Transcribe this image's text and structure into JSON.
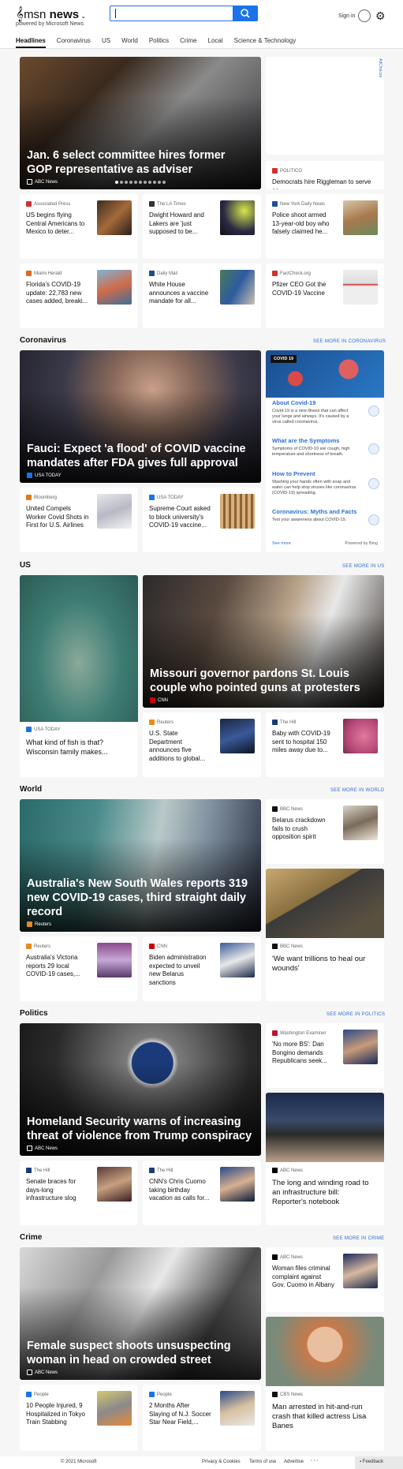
{
  "header": {
    "brand": "msn",
    "brand_suffix": "news",
    "powered": "powered by Microsoft News",
    "signin": "Sign in",
    "search_value": ""
  },
  "nav": [
    "Headlines",
    "Coronavirus",
    "US",
    "World",
    "Politics",
    "Crime",
    "Local",
    "Science & Technology"
  ],
  "top": {
    "hero": {
      "title": "Jan. 6 select committee hires former GOP representative as adviser",
      "source": "ABC News"
    },
    "ad_label": "AdChoices",
    "side": {
      "source": "POLITICO",
      "title": "Democrats hire Riggleman to serve as..."
    },
    "row1": [
      {
        "source": "Associated Press",
        "title": "US begins flying Central Americans to Mexico to deter..."
      },
      {
        "source": "The LA Times",
        "title": "Dwight Howard and Lakers are 'just supposed to be..."
      },
      {
        "source": "New York Daily News",
        "title": "Police shoot armed 13-year-old boy who falsely claimed he..."
      }
    ],
    "row2": [
      {
        "source": "Miami Herald",
        "title": "Florida's COVID-19 update: 22,783 new cases added, breaki..."
      },
      {
        "source": "Daily Mail",
        "title": "White House announces a vaccine mandate for all..."
      },
      {
        "source": "FactCheck.org",
        "title": "Pfizer CEO Got the COVID-19 Vaccine"
      }
    ]
  },
  "coronavirus": {
    "heading": "Coronavirus",
    "see_more": "SEE MORE IN CORONAVIRUS",
    "hero": {
      "title": "Fauci: Expect 'a flood' of COVID vaccine mandates after FDA gives full approval",
      "source": "USA TODAY"
    },
    "row": [
      {
        "source": "Bloomberg",
        "title": "United Compels Worker Covid Shots in First for U.S. Airlines"
      },
      {
        "source": "USA TODAY",
        "title": "Supreme Court asked to block university's COVID-19 vaccine..."
      }
    ],
    "panel": {
      "badge": "COVID 19",
      "items": [
        {
          "h": "About Covid-19",
          "d": "Covid-19 is a new illness that can affect your lungs and airways. It's caused by a virus called coronavirus."
        },
        {
          "h": "What are the Symptoms",
          "d": "Symptoms of COVID-19 are cough, high temperature and shortness of breath."
        },
        {
          "h": "How to Prevent",
          "d": "Washing your hands often with soap and water can help stop viruses like coronavirus (COVID-19) spreading."
        },
        {
          "h": "Coronavirus: Myths and Facts",
          "d": "Test your awareness about COVID-19."
        }
      ],
      "see_more": "See more",
      "powered": "Powered by Bing"
    }
  },
  "us": {
    "heading": "US",
    "see_more": "SEE MORE IN US",
    "left": {
      "source": "USA TODAY",
      "title": "What kind of fish is that? Wisconsin family makes..."
    },
    "hero": {
      "title": "Missouri governor pardons St. Louis couple who pointed guns at protesters",
      "source": "CNN"
    },
    "row": [
      {
        "source": "Reuters",
        "title": "U.S. State Department announces five additions to global..."
      },
      {
        "source": "The Hill",
        "title": "Baby with COVID-19 sent to hospital 150 miles away due to..."
      }
    ]
  },
  "world": {
    "heading": "World",
    "see_more": "SEE MORE IN WORLD",
    "hero": {
      "title": "Australia's New South Wales reports 319 new COVID-19 cases, third straight daily record",
      "source": "Reuters"
    },
    "side": {
      "source": "BBC News",
      "title": "Belarus crackdown fails to crush opposition spirit"
    },
    "row": [
      {
        "source": "Reuters",
        "title": "Australia's Victoria reports 29 local COVID-19 cases,..."
      },
      {
        "source": "CNN",
        "title": "Biden administration expected to unveil new Belarus sanctions"
      }
    ],
    "tall": {
      "source": "BBC News",
      "title": "'We want trillions to heal our wounds'"
    }
  },
  "politics": {
    "heading": "Politics",
    "see_more": "SEE MORE IN POLITICS",
    "hero": {
      "title": "Homeland Security warns of increasing threat of violence from Trump conspiracy",
      "source": "ABC News"
    },
    "side": {
      "source": "Washington Examiner",
      "title": "'No more BS': Dan Bongino demands Republicans seek..."
    },
    "row": [
      {
        "source": "The Hill",
        "title": "Senate braces for days-long infrastructure slog"
      },
      {
        "source": "The Hill",
        "title": "CNN's Chris Cuomo taking birthday vacation as calls for..."
      }
    ],
    "tall": {
      "source": "ABC News",
      "title": "The long and winding road to an infrastructure bill: Reporter's notebook"
    }
  },
  "crime": {
    "heading": "Crime",
    "see_more": "SEE MORE IN CRIME",
    "hero": {
      "title": "Female suspect shoots unsuspecting woman in head on crowded street",
      "source": "ABC News"
    },
    "side": {
      "source": "ABC News",
      "title": "Woman files criminal complaint against Gov. Cuomo in Albany"
    },
    "row": [
      {
        "source": "People",
        "title": "10 People Injured, 9 Hospitalized in Tokyo Train Stabbing"
      },
      {
        "source": "People",
        "title": "2 Months After Slaying of N.J. Soccer Star Near Field,..."
      }
    ],
    "tall": {
      "source": "CBS News",
      "title": "Man arrested in hit-and-run crash that killed actress Lisa Banes"
    }
  },
  "footer": {
    "copyright": "© 2021 Microsoft",
    "links": [
      "Privacy & Cookies",
      "Terms of use",
      "Advertise"
    ],
    "more": "· · ·",
    "feedback": "Feedback"
  }
}
